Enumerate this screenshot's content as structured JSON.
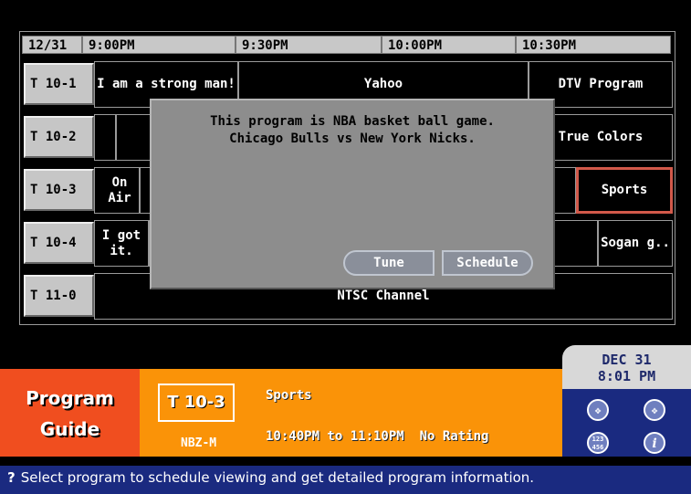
{
  "header": {
    "date": "12/31",
    "slots": [
      "9:00PM",
      "9:30PM",
      "10:00PM",
      "10:30PM"
    ]
  },
  "channels": [
    {
      "id": "T 10-1",
      "programs": [
        "I am a strong man!",
        "Yahoo",
        "DTV Program"
      ]
    },
    {
      "id": "T 10-2",
      "programs": [
        "True Colors"
      ]
    },
    {
      "id": "T 10-3",
      "programs": [
        "On Air",
        "Sports"
      ]
    },
    {
      "id": "T 10-4",
      "programs": [
        "I got it.",
        "Sogan g.."
      ]
    },
    {
      "id": "T 11-0",
      "programs": [
        "NTSC Channel"
      ]
    }
  ],
  "popup": {
    "line1": "This program is NBA basket ball game.",
    "line2": "Chicago Bulls vs New York Nicks.",
    "tune_label": "Tune",
    "schedule_label": "Schedule"
  },
  "guide": {
    "line1": "Program",
    "line2": "Guide"
  },
  "info": {
    "channel": "T 10-3",
    "network": "NBZ-M",
    "program": "Sports",
    "time": "10:40PM to 11:10PM",
    "rating": "No Rating"
  },
  "clock": {
    "date": "DEC 31",
    "time": "8:01 PM"
  },
  "icons": [
    "move-icon",
    "move-icon",
    "number-pad-icon",
    "info-icon"
  ],
  "status_text": "Select program to schedule viewing and get detailed program information.",
  "colors": {
    "guide_bg": "#f04e1f",
    "info_bg": "#fa9308",
    "panel_bg": "#1a2a80",
    "selection": "#d2594a"
  }
}
